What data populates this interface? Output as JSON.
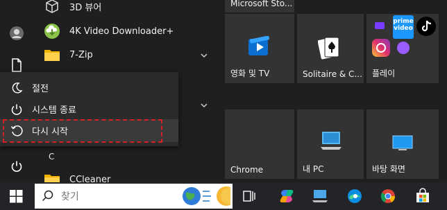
{
  "apps": [
    {
      "label": "3D 뷰어",
      "icon": "cube-icon"
    },
    {
      "label": "4K Video Downloader+",
      "icon": "download-cloud-icon"
    },
    {
      "label": "7-Zip",
      "icon": "folder-icon"
    }
  ],
  "section_letter": "C",
  "ccleaner": {
    "label": "CCleaner",
    "icon": "folder-icon"
  },
  "power_menu": [
    {
      "label": "절전",
      "icon": "moon-icon"
    },
    {
      "label": "시스템 종료",
      "icon": "power-icon"
    },
    {
      "label": "다시 시작",
      "icon": "restart-icon"
    }
  ],
  "tiles": {
    "microsoft_store": "Microsoft Sto...",
    "movies_tv": "영화 및 TV",
    "solitaire": "Solitaire & C...",
    "play": "플레이",
    "chrome": "Chrome",
    "my_pc": "내 PC",
    "desktop": "바탕 화면"
  },
  "search": {
    "placeholder": "찾기"
  },
  "colors": {
    "highlight": "#d61f26",
    "accent": "#0078d4",
    "tile": "#333333"
  }
}
